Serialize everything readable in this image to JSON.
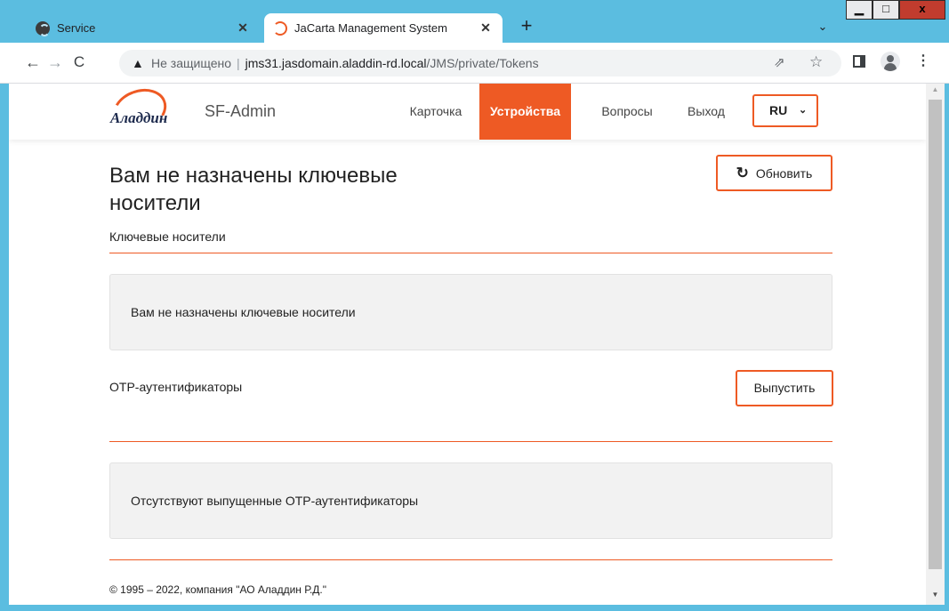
{
  "browser": {
    "tabs": [
      {
        "title": "Service",
        "icon": "globe-icon",
        "active": false
      },
      {
        "title": "JaCarta Management System",
        "icon": "spinner-icon",
        "active": true
      }
    ],
    "new_tab_label": "+",
    "tab_menu_label": "⌄",
    "window_buttons": {
      "minimize": "▁",
      "maximize": "□",
      "close": "x"
    },
    "nav": {
      "back": "←",
      "forward": "→",
      "reload": "C"
    },
    "address": {
      "security_label": "Не защищено",
      "host": "jms31.jasdomain.aladdin-rd.local",
      "path": "/JMS/private/Tokens"
    }
  },
  "site": {
    "logo_text": "Аладдин",
    "app_name": "SF-Admin",
    "nav": [
      {
        "label": "Карточка",
        "active": false
      },
      {
        "label": "Устройства",
        "active": true
      },
      {
        "label": "Вопросы",
        "active": false
      },
      {
        "label": "Выход",
        "active": false
      }
    ],
    "language": "RU",
    "accent_color": "#ee5a24"
  },
  "content": {
    "title": "Вам не назначены ключевые носители",
    "refresh_label": "Обновить",
    "tokens_section_label": "Ключевые носители",
    "tokens_message": "Вам не назначены ключевые носители",
    "otp_section_label": "OTP-аутентификаторы",
    "issue_label": "Выпустить",
    "otp_message": "Отсутствуют выпущенные OTP-аутентификаторы",
    "footer": "© 1995 – 2022, компания \"АО Аладдин Р.Д.\""
  }
}
